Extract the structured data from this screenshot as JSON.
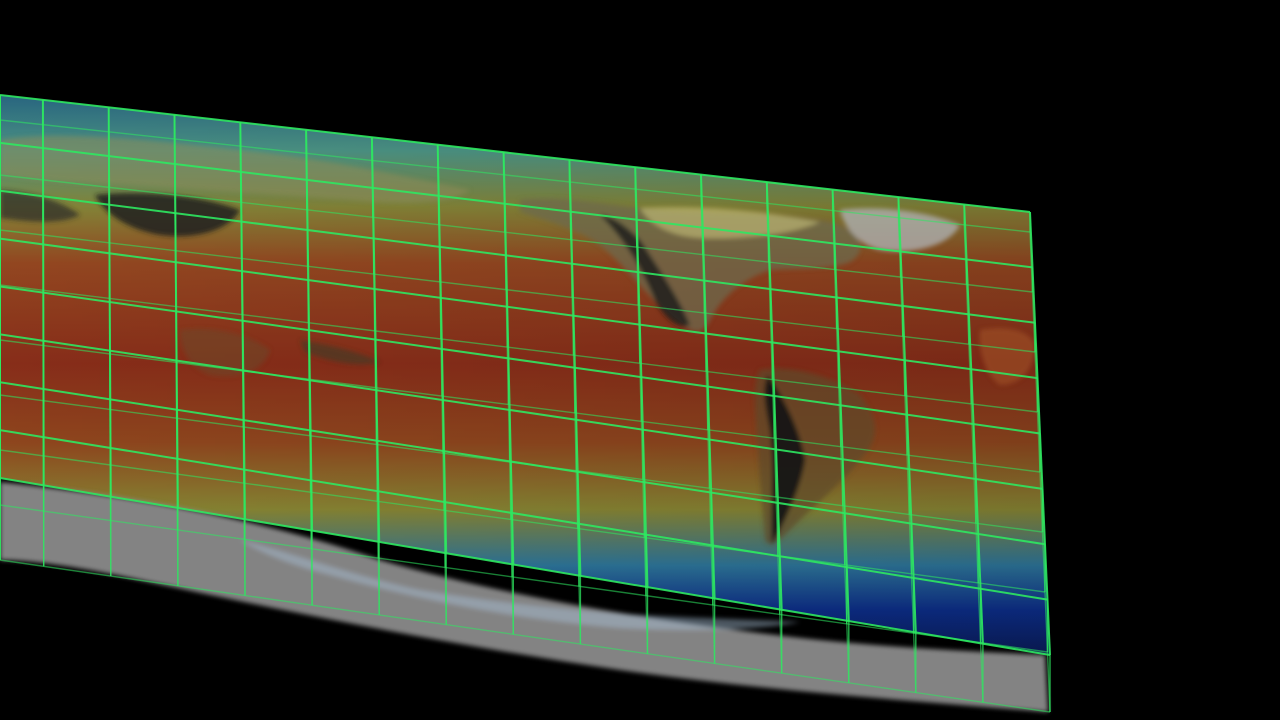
{
  "scene": {
    "background_color": "#000000",
    "grid_color": "#2ee860",
    "surface_colormap": [
      "#0a1a6e",
      "#1f5aa8",
      "#3f8fa8",
      "#6f9a55",
      "#a88a2a",
      "#a8551e",
      "#8a2a1a"
    ],
    "terrain_color": "#8a8a8a",
    "ice_color": "#9aa0a6",
    "grid_columns": 18,
    "grid_rows": 8,
    "vertical_layers": 2,
    "projection": "equirectangular"
  }
}
